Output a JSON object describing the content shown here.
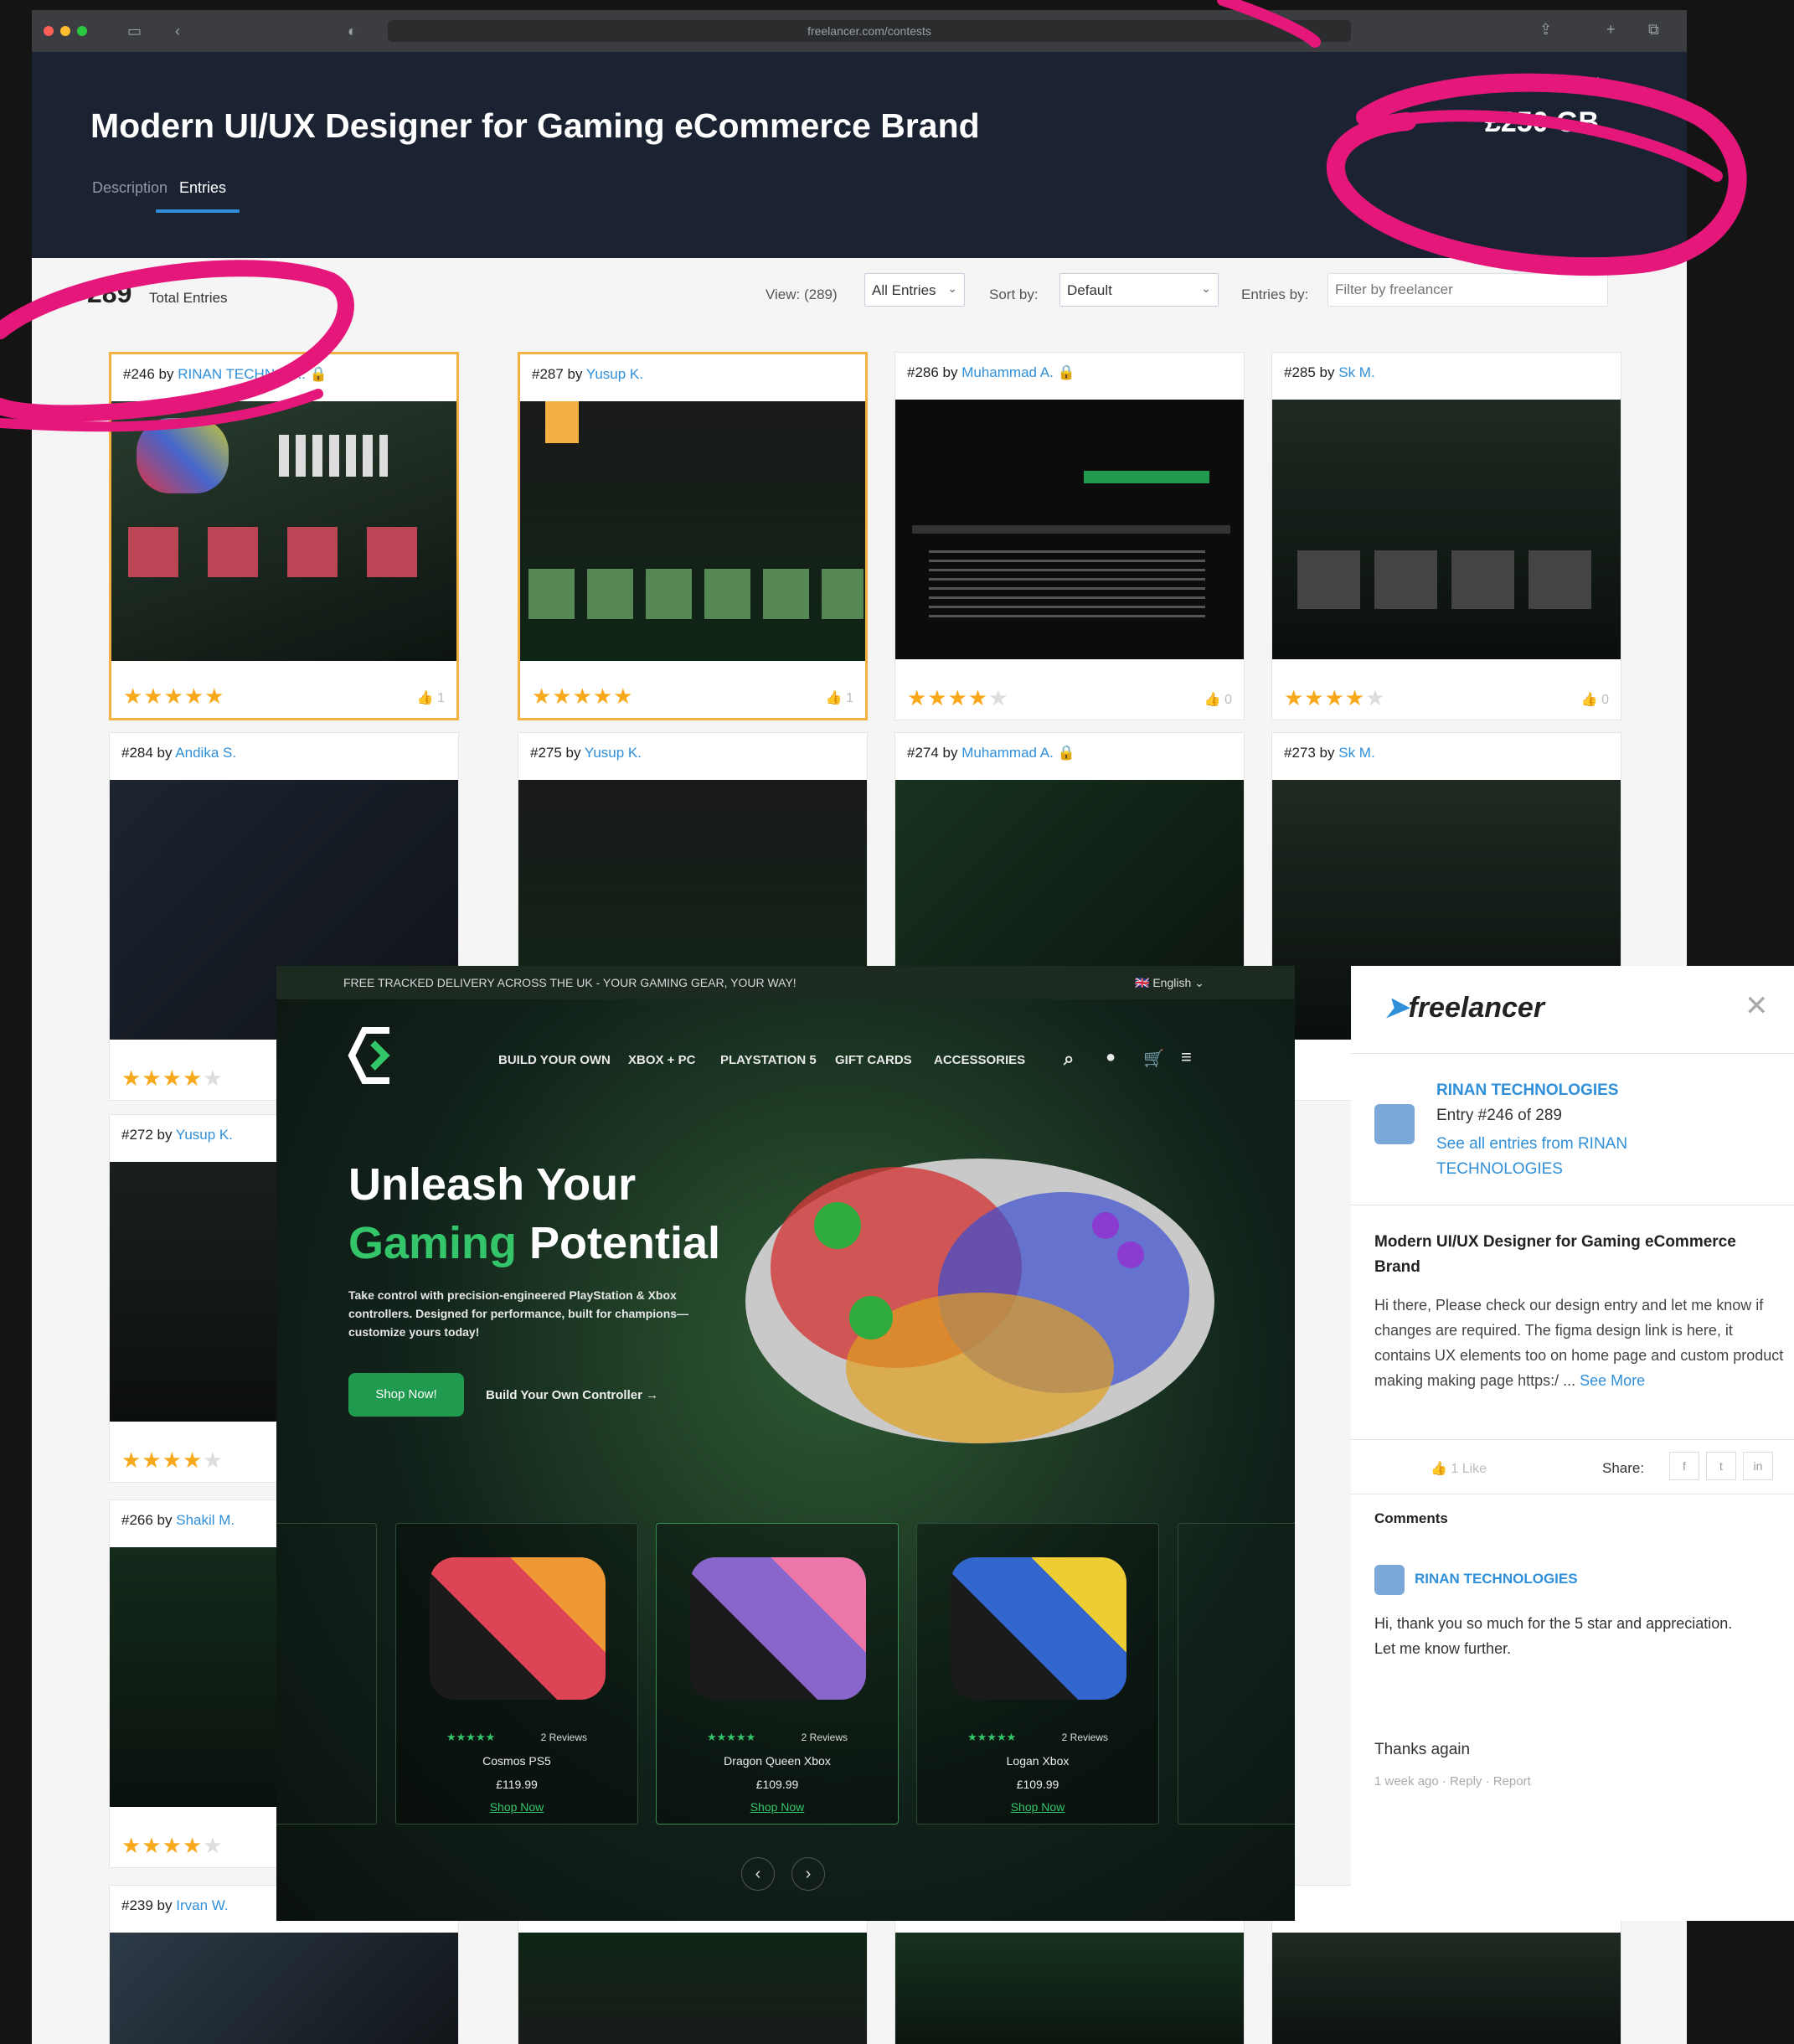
{
  "browser": {
    "url": "freelancer.com/contests"
  },
  "contest": {
    "title": "Modern UI/UX Designer for Gaming eCommerce Brand",
    "budget": "£250 GB",
    "tabs": [
      "Description",
      "Entries"
    ]
  },
  "toolbar": {
    "total_count": "289",
    "total_label": "Total Entries",
    "view_label": "View: (289)",
    "view_value": "All Entries",
    "sort_label": "Sort by:",
    "sort_value": "Default",
    "entries_by_label": "Entries by:",
    "filter_placeholder": "Filter by freelancer"
  },
  "entries": [
    {
      "num": "#246 by",
      "author": "RINAN TECHNOL...",
      "rating": 5,
      "likes": "1"
    },
    {
      "num": "#287 by",
      "author": "Yusup K.",
      "rating": 5,
      "likes": "1"
    },
    {
      "num": "#286 by",
      "author": "Muhammad A.",
      "rating": 4,
      "likes": "0"
    },
    {
      "num": "#285 by",
      "author": "Sk M.",
      "rating": 4,
      "likes": "0"
    },
    {
      "num": "#284 by",
      "author": "Andika S.",
      "rating": 4
    },
    {
      "num": "#275 by",
      "author": "Yusup K."
    },
    {
      "num": "#274 by",
      "author": "Muhammad A."
    },
    {
      "num": "#273 by",
      "author": "Sk M."
    },
    {
      "num": "#272 by",
      "author": "Yusup K.",
      "rating": 4
    },
    {
      "num": "#266 by",
      "author": "Shakil M.",
      "rating": 4
    },
    {
      "num": "#239 by",
      "author": "Irvan W."
    }
  ],
  "preview": {
    "topbar": "FREE TRACKED DELIVERY ACROSS THE UK - YOUR GAMING GEAR, YOUR WAY!",
    "language": "English",
    "nav": [
      "BUILD YOUR OWN",
      "XBOX + PC",
      "PLAYSTATION 5",
      "GIFT CARDS",
      "ACCESSORIES"
    ],
    "heading_line1": "Unleash Your",
    "heading_line2_green": "Gaming",
    "heading_line2_rest": " Potential",
    "lead": "Take control with precision-engineered PlayStation & Xbox controllers. Designed for performance, built for champions—customize yours today!",
    "shop_button": "Shop Now!",
    "build_link": "Build Your Own Controller →",
    "products": [
      {
        "name": "Cosmos PS5",
        "price": "£119.99",
        "reviews": "2 Reviews",
        "link": "Shop Now"
      },
      {
        "name": "Dragon Queen Xbox",
        "price": "£109.99",
        "reviews": "2 Reviews",
        "link": "Shop Now"
      },
      {
        "name": "Logan Xbox",
        "price": "£109.99",
        "reviews": "2 Reviews",
        "link": "Shop Now"
      }
    ]
  },
  "sidepanel": {
    "logo": "freelancer",
    "seller": "RINAN TECHNOLOGIES",
    "entry": "Entry #246 of 289",
    "see_all": "See all entries from RINAN TECHNOLOGIES",
    "title": "Modern UI/UX Designer for Gaming eCommerce Brand",
    "description": "Hi there, Please check our design entry and let me know if changes are required. The figma design link is here, it contains UX elements too on home page and custom product making making page https:/ ...",
    "see_more": "See More",
    "like": "1 Like",
    "share_label": "Share:",
    "comments_label": "Comments",
    "comment_author": "RINAN TECHNOLOGIES",
    "comment_text": "Hi, thank you so much for the 5 star and appreciation. Let me know further.",
    "thanks": "Thanks again",
    "meta": "1 week ago · Reply · Report"
  },
  "colors": {
    "header_bg": "#1b2333",
    "accent_blue": "#2f8fd9",
    "star_gold": "#f7a81b",
    "brand_green": "#34c46a",
    "annotation_pink": "#e6177a"
  }
}
